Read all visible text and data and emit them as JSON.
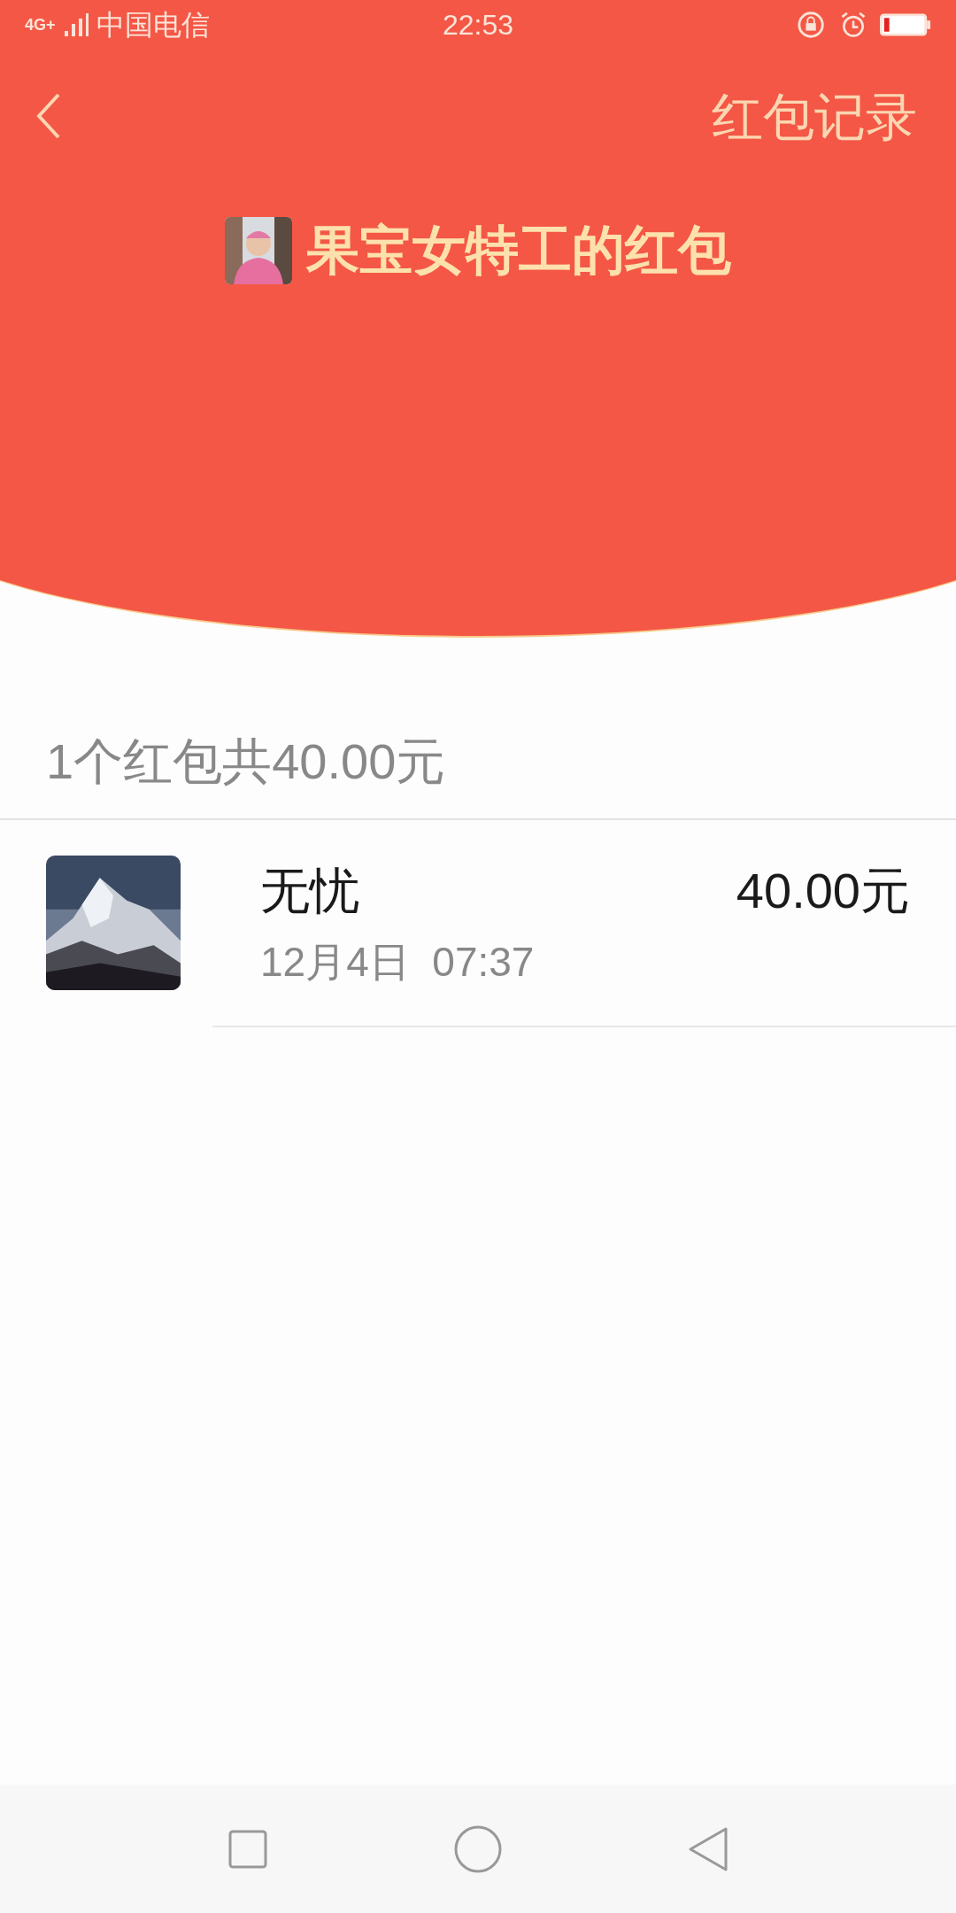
{
  "status_bar": {
    "network": "4G+",
    "carrier": "中国电信",
    "time": "22:53"
  },
  "header": {
    "title": "红包记录"
  },
  "sender": {
    "name": "果宝女特工的红包"
  },
  "summary": "1个红包共40.00元",
  "records": [
    {
      "name": "无忧",
      "time": "12月4日  07:37",
      "amount": "40.00元"
    }
  ]
}
